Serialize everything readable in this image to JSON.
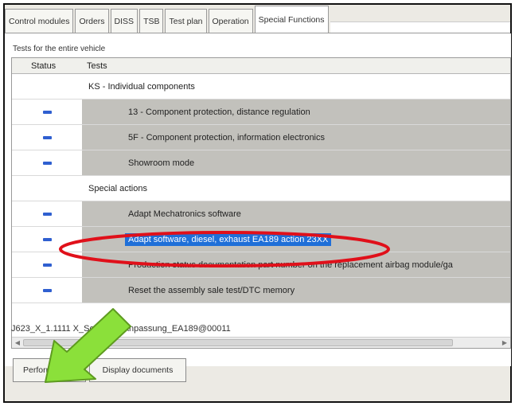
{
  "tabs": [
    {
      "label": "Control modules"
    },
    {
      "label": "Orders"
    },
    {
      "label": "DISS"
    },
    {
      "label": "TSB"
    },
    {
      "label": "Test plan"
    },
    {
      "label": "Operation"
    },
    {
      "label": "Special Functions"
    }
  ],
  "panel": {
    "section_title": "Tests for the entire vehicle",
    "columns": {
      "status": "Status",
      "tests": "Tests"
    }
  },
  "rows": [
    {
      "type": "group",
      "label": "KS - Individual components"
    },
    {
      "type": "item",
      "label": "13 - Component protection, distance regulation"
    },
    {
      "type": "item",
      "label": "5F - Component protection, information electronics"
    },
    {
      "type": "item",
      "label": "Showroom mode"
    },
    {
      "type": "group",
      "label": "Special actions"
    },
    {
      "type": "item",
      "label": "Adapt Mechatronics software"
    },
    {
      "type": "item",
      "label": "Adapt software, diesel, exhaust EA189 action 23XX",
      "selected": true
    },
    {
      "type": "item",
      "label": "Production status documentation part number on the replacement airbag module/ga"
    },
    {
      "type": "item",
      "label": "Reset the assembly sale test/DTC memory"
    }
  ],
  "info_line": "J623_X_1.1111 X_Software_Anpassung_EA189@00011",
  "buttons": {
    "perform_test": "Perform test...",
    "display_documents": "Display documents"
  },
  "colors": {
    "status_dash": "#2f5fd0",
    "selection": "#1f6fd8",
    "callout_ellipse": "#e0101a",
    "callout_arrow": "#8be03a"
  }
}
